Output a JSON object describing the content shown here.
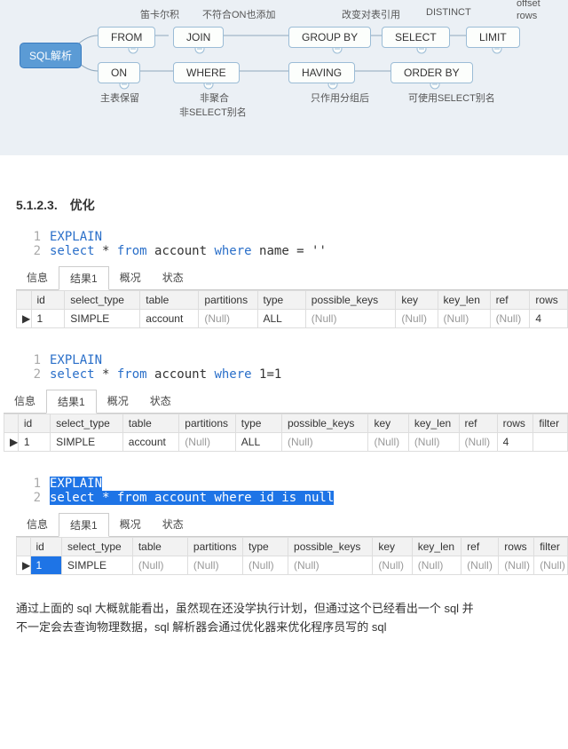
{
  "diagram": {
    "root": "SQL解析",
    "nodes": {
      "from": "FROM",
      "join": "JOIN",
      "groupby": "GROUP BY",
      "select": "SELECT",
      "limit": "LIMIT",
      "on": "ON",
      "where": "WHERE",
      "having": "HAVING",
      "orderby": "ORDER BY"
    },
    "labels": {
      "from_top": "笛卡尔积",
      "join_top": "不符合ON也添加",
      "groupby_top": "改变对表引用",
      "select_top": "DISTINCT",
      "limit_top_a": "offset",
      "limit_top_b": "rows",
      "on_bottom": "主表保留",
      "where_bottom_a": "非聚合",
      "where_bottom_b": "非SELECT别名",
      "having_bottom": "只作用分组后",
      "orderby_bottom": "可使用SELECT别名"
    }
  },
  "heading": "5.1.2.3.　优化",
  "code_blocks": {
    "a": {
      "line1": "EXPLAIN",
      "line2_pre": "select",
      "line2_mid": " * ",
      "line2_from": "from",
      "line2_tbl": " account ",
      "line2_where": "where",
      "line2_name": " name = ''"
    },
    "b": {
      "line1": "EXPLAIN",
      "line2_pre": "select",
      "line2_mid": " * ",
      "line2_from": "from",
      "line2_tbl": " account ",
      "line2_where": "where",
      "line2_cond": " 1=1"
    },
    "c": {
      "line1": "EXPLAIN",
      "line2": "select * from account where id is null"
    }
  },
  "tabs": {
    "info": "信息",
    "result": "结果1",
    "profile": "概况",
    "state": "状态"
  },
  "columns": {
    "id": "id",
    "select_type": "select_type",
    "table": "table",
    "partitions": "partitions",
    "type": "type",
    "possible_keys": "possible_keys",
    "key": "key",
    "key_len": "key_len",
    "ref": "ref",
    "rows": "rows",
    "filter": "filter"
  },
  "null_label": "(Null)",
  "row_marker": "▶",
  "rows_a": {
    "id": "1",
    "select_type": "SIMPLE",
    "table": "account",
    "type": "ALL",
    "rows": "4"
  },
  "rows_b": {
    "id": "1",
    "select_type": "SIMPLE",
    "table": "account",
    "type": "ALL",
    "rows": "4"
  },
  "rows_c": {
    "id": "1",
    "select_type": "SIMPLE"
  },
  "body_text_1": "通过上面的 sql 大概就能看出，虽然现在还没学执行计划，但通过这个已经看出一个 sql 并",
  "body_text_2": "不一定会去查询物理数据，sql 解析器会通过优化器来优化程序员写的 sql"
}
